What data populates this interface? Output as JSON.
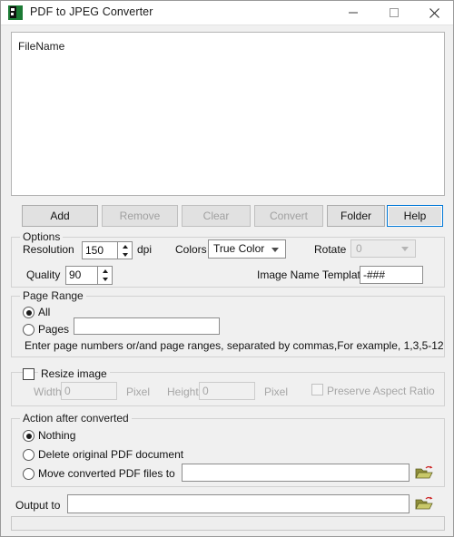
{
  "window": {
    "title": "PDF to JPEG Converter",
    "icon": "app-icon",
    "controls": {
      "minimize": "minimize-icon",
      "maximize": "maximize-icon",
      "close": "close-icon"
    }
  },
  "file_list": {
    "column_header": "FileName",
    "rows": []
  },
  "toolbar": {
    "add_label": "Add",
    "remove_label": "Remove",
    "clear_label": "Clear",
    "convert_label": "Convert",
    "folder_label": "Folder",
    "help_label": "Help"
  },
  "options": {
    "legend": "Options",
    "resolution_label": "Resolution",
    "resolution_value": "150",
    "dpi_label": "dpi",
    "colors_label": "Colors",
    "colors_value": "True Color",
    "rotate_label": "Rotate",
    "rotate_value": "0",
    "quality_label": "Quality",
    "quality_value": "90",
    "image_name_template_label": "Image Name Template",
    "image_name_template_value": "-###"
  },
  "page_range": {
    "legend": "Page Range",
    "all_label": "All",
    "pages_label": "Pages",
    "pages_value": "",
    "hint": "Enter page numbers or/and page ranges, separated by commas,For example, 1,3,5-12"
  },
  "resize": {
    "checkbox_label": "Resize image",
    "width_label": "Width",
    "width_value": "0",
    "width_unit": "Pixel",
    "height_label": "Height",
    "height_value": "0",
    "height_unit": "Pixel",
    "preserve_aspect_label": "Preserve Aspect Ratio"
  },
  "action_after": {
    "legend": "Action after converted",
    "nothing_label": "Nothing",
    "delete_label": "Delete original PDF document",
    "move_label": "Move converted PDF files to",
    "move_path_value": "",
    "browse_icon": "open-folder-icon"
  },
  "output": {
    "label": "Output to",
    "value": "",
    "browse_icon": "open-folder-icon"
  },
  "status": {
    "text": ""
  },
  "colors": {
    "accent": "#0078d7",
    "window_bg": "#f0f0f0",
    "field_bg": "#ffffff",
    "disabled_text": "#a6a6a6",
    "folder_icon": "#8f8f3a"
  }
}
